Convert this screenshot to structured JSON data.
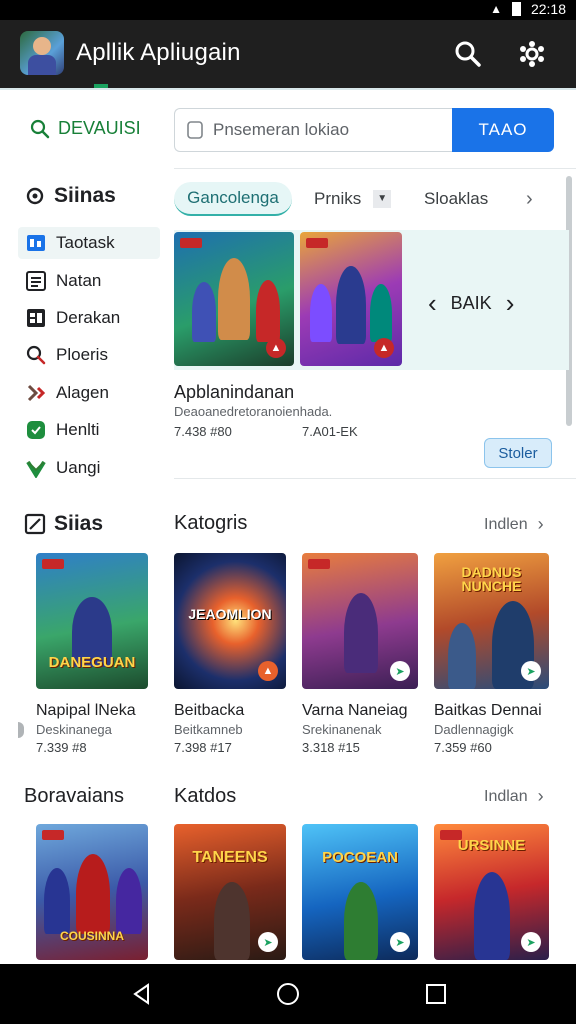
{
  "status_bar": {
    "time": "22:18"
  },
  "app_bar": {
    "title": "Apllik Apliugain",
    "icons": [
      "search-icon",
      "settings-icon"
    ]
  },
  "left_search": {
    "label": "DEVAUISI",
    "icon": "search-icon"
  },
  "search": {
    "placeholder": "Pnsemeran lokiao",
    "button_label": "TAAO"
  },
  "sidebar": {
    "heading_top": "Siinas",
    "items": [
      {
        "label": "Taotask",
        "icon": "grid-icon"
      },
      {
        "label": "Natan",
        "icon": "list-icon"
      },
      {
        "label": "Derakan",
        "icon": "board-icon"
      },
      {
        "label": "Ploeris",
        "icon": "magnify-icon"
      },
      {
        "label": "Alagen",
        "icon": "share-icon"
      },
      {
        "label": "Henlti",
        "icon": "shield-icon"
      },
      {
        "label": "Uangi",
        "icon": "check-icon"
      }
    ],
    "heading_bottom": "Siias"
  },
  "tabs": [
    "Gancolenga",
    "Prniks",
    "Sloaklas"
  ],
  "featured": {
    "nav_label": "BAIK",
    "title": "Apblanindanan",
    "subtitle": "Deaoanedretoranoienhada.",
    "meta": [
      "7.438 #80",
      "7.A01-EK"
    ],
    "store_button": "Stoler"
  },
  "section1": {
    "title": "Katogris",
    "more": "Indlen",
    "games": [
      {
        "name": "Napipal lNeka",
        "dev": "Deskinanega",
        "meta": "7.339 #8",
        "cover_title": "DANEGUAN"
      },
      {
        "name": "Beitbacka",
        "dev": "Beitkamneb",
        "meta": "7.398 #17",
        "cover_title": "JEAOMLION"
      },
      {
        "name": "Varna Naneiag",
        "dev": "Srekinanenak",
        "meta": "3.318 #15",
        "cover_title": ""
      },
      {
        "name": "Baitkas Dennai",
        "dev": "Dadlennagigk",
        "meta": "7.359 #60",
        "cover_title": "DADNUS NUNCHE"
      }
    ]
  },
  "section2": {
    "left_title": "Boravaians",
    "title": "Katdos",
    "more": "Indlan",
    "games": [
      {
        "cover_title": "COUSINNA"
      },
      {
        "cover_title": "TANEENS"
      },
      {
        "cover_title": "POCOEAN"
      },
      {
        "cover_title": "URSINNE"
      }
    ]
  },
  "colors": {
    "accent": "#1a73e8",
    "green": "#188038",
    "appbar": "#1f1f1f",
    "feature_bg": "#e9f6f5"
  }
}
